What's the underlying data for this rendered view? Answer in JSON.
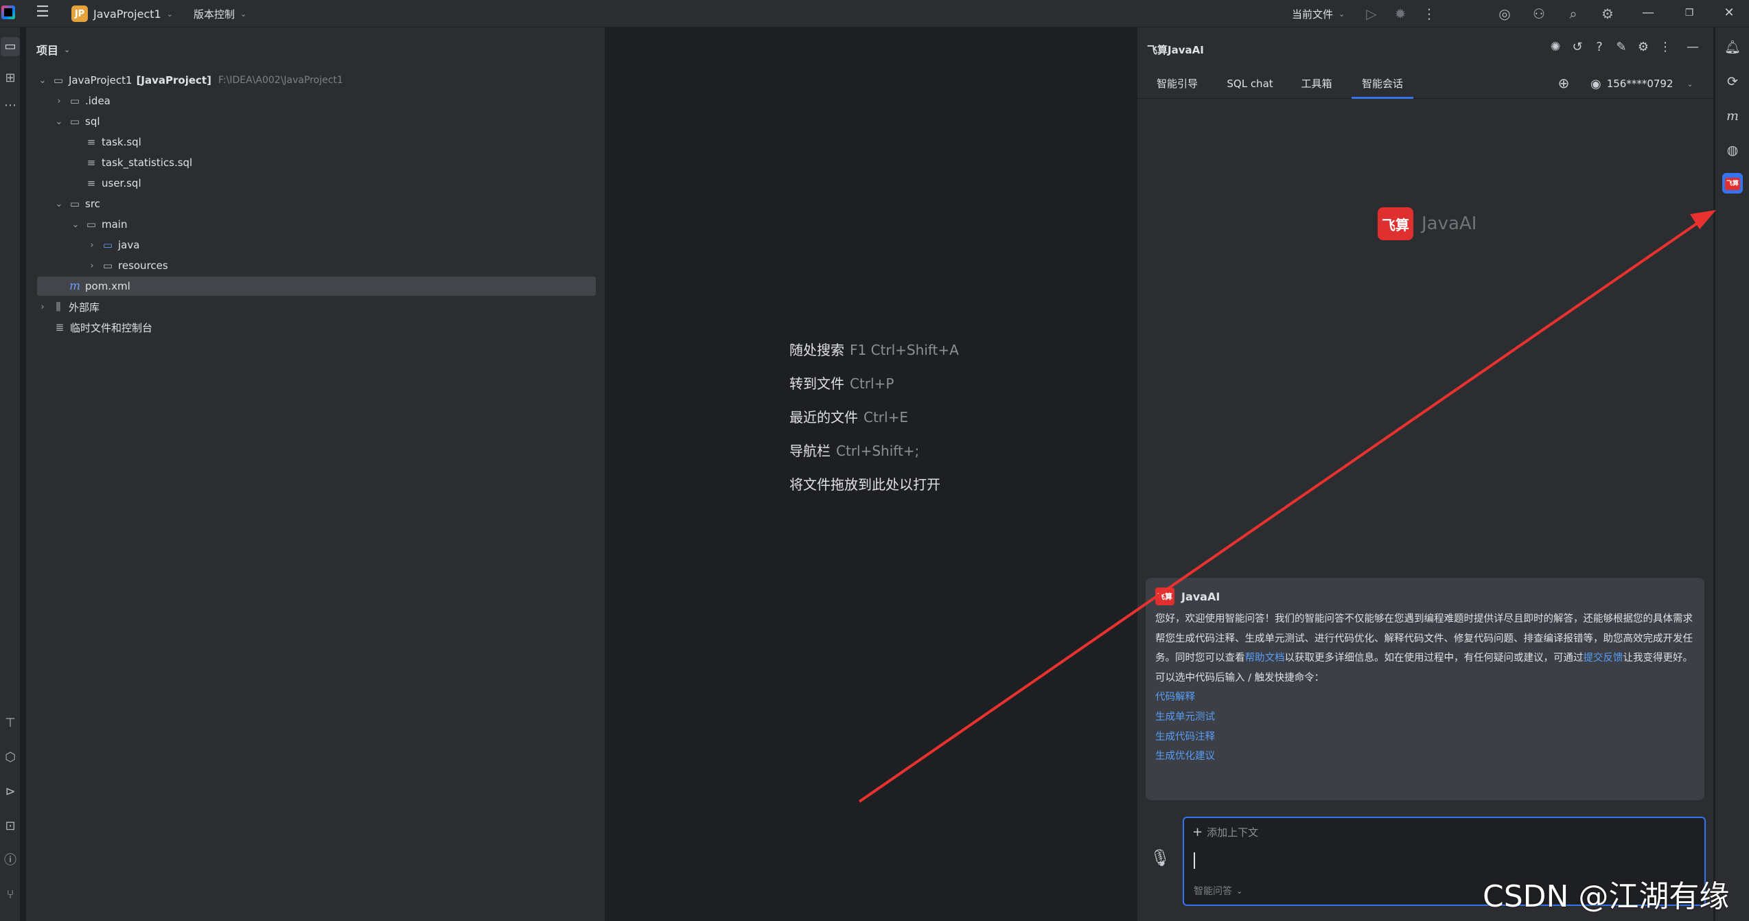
{
  "titlebar": {
    "project_badge": "JP",
    "project_name": "JavaProject1",
    "vcs_label": "版本控制",
    "current_file_label": "当前文件"
  },
  "project_panel": {
    "header": "项目",
    "tree": [
      {
        "label": "JavaProject1",
        "extra_bold": "[JavaProject]",
        "path": "F:\\IDEA\\A002\\JavaProject1"
      },
      {
        "label": ".idea"
      },
      {
        "label": "sql"
      },
      {
        "label": "task.sql"
      },
      {
        "label": "task_statistics.sql"
      },
      {
        "label": "user.sql"
      },
      {
        "label": "src"
      },
      {
        "label": "main"
      },
      {
        "label": "java"
      },
      {
        "label": "resources"
      },
      {
        "label": "pom.xml"
      },
      {
        "label": "外部库"
      },
      {
        "label": "临时文件和控制台"
      }
    ]
  },
  "editor": {
    "hints": [
      {
        "label": "随处搜索",
        "key": "F1 Ctrl+Shift+A"
      },
      {
        "label": "转到文件",
        "key": "Ctrl+P"
      },
      {
        "label": "最近的文件",
        "key": "Ctrl+E"
      },
      {
        "label": "导航栏",
        "key": "Ctrl+Shift+;"
      },
      {
        "label": "将文件拖放到此处以打开",
        "key": ""
      }
    ]
  },
  "ai_panel": {
    "title": "飞算JavaAI",
    "tabs": [
      "智能引导",
      "SQL chat",
      "工具箱",
      "智能会话"
    ],
    "active_tab": "智能会话",
    "user": "156****0792",
    "logo_mark": "飞算",
    "logo_text": "JavaAI",
    "message": {
      "sender": "JavaAI",
      "p1": "您好，欢迎使用智能问答！我们的智能问答不仅能够在您遇到编程难题时提供详尽且即时的解答，还能够根据您的具体需求帮您生成代码注释、生成单元测试、进行代码优化、解释代码文件、修复代码问题、排查编译报错等，助您高效完成开发任务。同时您可以查看",
      "link1": "帮助文档",
      "p2": "以获取更多详细信息。如在使用过程中，有任何疑问或建议，可通过",
      "link2": "提交反馈",
      "p3": "让我变得更好。",
      "p4": "可以选中代码后输入 / 触发快捷命令：",
      "commands": [
        "代码解释",
        "生成单元测试",
        "生成代码注释",
        "生成优化建议"
      ]
    },
    "input": {
      "add_context": "添加上下文",
      "mode": "智能问答"
    }
  },
  "watermark": "CSDN @江湖有缘",
  "colors": {
    "accent": "#3574f0",
    "brand_red": "#e02f2f",
    "link": "#589df6",
    "annotation_arrow": "#e8322f"
  }
}
